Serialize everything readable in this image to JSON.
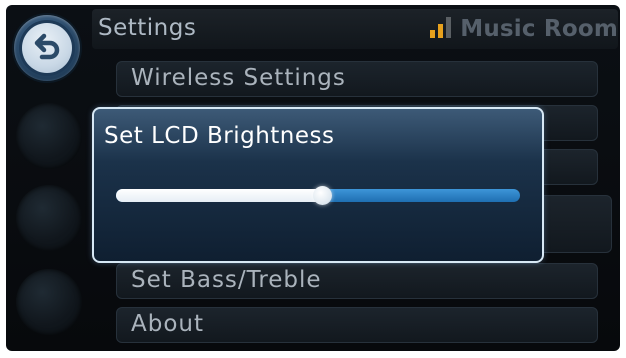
{
  "header": {
    "title": "Settings",
    "room": "Music Room",
    "signal_icon": "signal-bars-icon"
  },
  "back_button": {
    "icon": "back-arrow-icon"
  },
  "menu": {
    "items": [
      {
        "label": "Wireless Settings"
      },
      {
        "label": ""
      },
      {
        "label": ""
      },
      {
        "label": ""
      },
      {
        "label": "Set Bass/Treble"
      },
      {
        "label": "About"
      }
    ]
  },
  "dialog": {
    "title": "Set LCD Brightness",
    "brightness_level": 0.51
  },
  "colors": {
    "accent": "#2a86cc",
    "signal": "#e7a11d"
  }
}
